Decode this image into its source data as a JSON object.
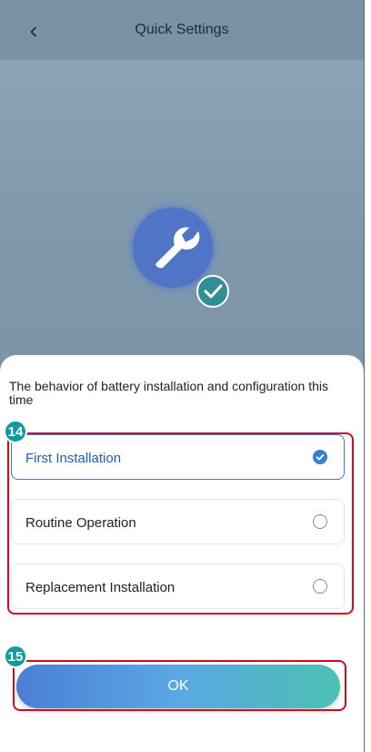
{
  "header": {
    "back_icon": "chevron-left-icon",
    "back_glyph": "‹",
    "title": "Quick Settings"
  },
  "hero": {
    "icon": "wrench-check-icon"
  },
  "sheet": {
    "title": "The behavior of battery installation and configuration this time",
    "options": [
      {
        "label": "First Installation",
        "selected": true
      },
      {
        "label": "Routine Operation",
        "selected": false
      },
      {
        "label": "Replacement Installation",
        "selected": false
      }
    ],
    "ok_label": "OK"
  },
  "annotations": {
    "options_badge": "14",
    "ok_badge": "15",
    "highlight_color": "#d20c1a",
    "badge_color": "#0f9aa0"
  },
  "colors": {
    "accent": "#3a7bd5",
    "button_gradient_start": "#4a7fd6",
    "button_gradient_end": "#4cc0b2"
  }
}
